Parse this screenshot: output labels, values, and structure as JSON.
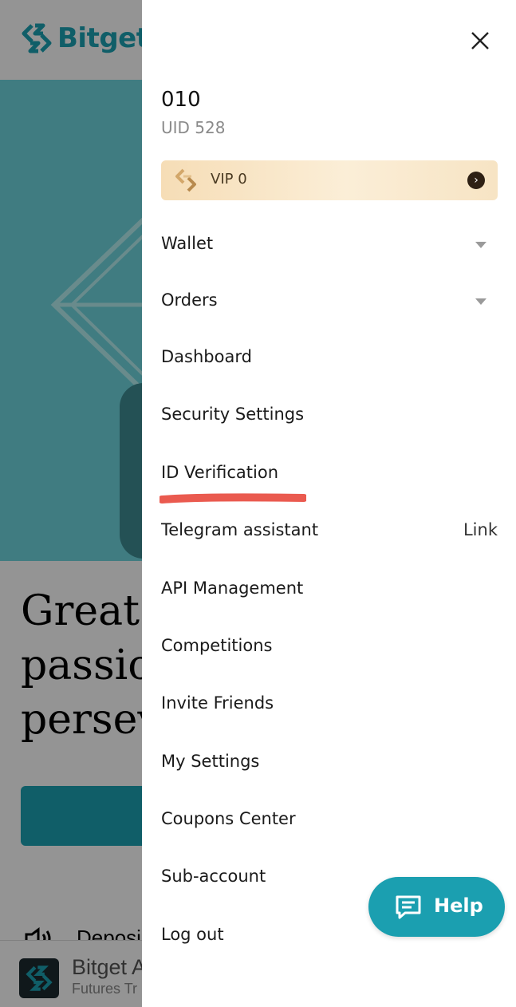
{
  "background": {
    "logo_text": "Bitget",
    "headline_lines": [
      "Great",
      "passio",
      "persev"
    ],
    "notice_text": "Deposi",
    "app_banner": {
      "name": "Bitget A",
      "subtitle": "Futures Tr"
    }
  },
  "drawer": {
    "user": {
      "name": "010",
      "uid": "UID 528"
    },
    "vip": {
      "label": "VIP 0",
      "arrow": "›"
    },
    "menu": [
      {
        "label": "Wallet",
        "expandable": true
      },
      {
        "label": "Orders",
        "expandable": true
      },
      {
        "label": "Dashboard"
      },
      {
        "label": "Security Settings"
      },
      {
        "label": "ID Verification"
      },
      {
        "label": "Telegram assistant",
        "action": "Link"
      },
      {
        "label": "API Management"
      },
      {
        "label": "Competitions"
      },
      {
        "label": "Invite Friends"
      },
      {
        "label": "My Settings"
      },
      {
        "label": "Coupons Center"
      },
      {
        "label": "Sub-account"
      },
      {
        "label": "Log out"
      }
    ]
  },
  "help_button": {
    "label": "Help"
  },
  "colors": {
    "brand": "#1da2b4",
    "help": "#1b9fb0",
    "annotation": "#ea5a4f",
    "vip_gold": "#f6ddb6"
  },
  "icons": [
    "bitget-logo-icon",
    "close-icon",
    "vip-icon",
    "chevron-right-icon",
    "caret-down-icon",
    "chat-icon",
    "speaker-icon"
  ]
}
